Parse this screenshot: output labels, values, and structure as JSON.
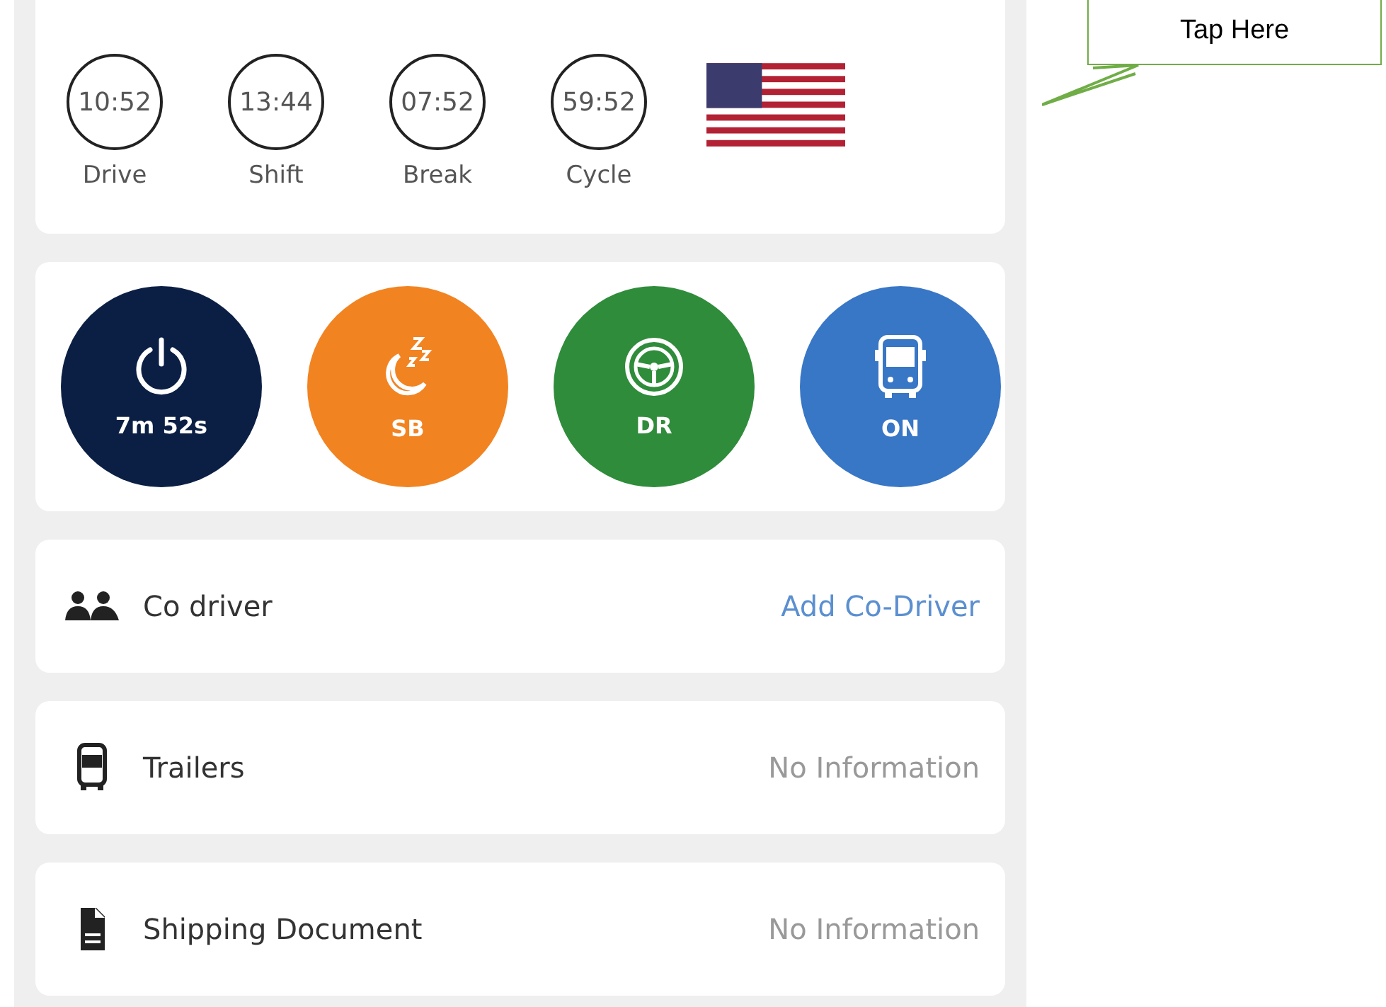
{
  "timers": [
    {
      "value": "10:52",
      "label": "Drive"
    },
    {
      "value": "13:44",
      "label": "Shift"
    },
    {
      "value": "07:52",
      "label": "Break"
    },
    {
      "value": "59:52",
      "label": "Cycle"
    }
  ],
  "status_buttons": [
    {
      "kind": "off",
      "label": "7m 52s",
      "color": "#0b1f44"
    },
    {
      "kind": "sleeper",
      "label": "SB",
      "color": "#f28321"
    },
    {
      "kind": "driving",
      "label": "DR",
      "color": "#2f8c3a"
    },
    {
      "kind": "on_duty",
      "label": "ON",
      "color": "#3876c6"
    }
  ],
  "info_rows": [
    {
      "kind": "co_driver",
      "label": "Co driver",
      "value": "Add Co-Driver",
      "link": true
    },
    {
      "kind": "trailers",
      "label": "Trailers",
      "value": "No Information",
      "link": false
    },
    {
      "kind": "document",
      "label": "Shipping Document",
      "value": "No Information",
      "link": false
    }
  ],
  "callout": {
    "text": "Tap Here"
  }
}
